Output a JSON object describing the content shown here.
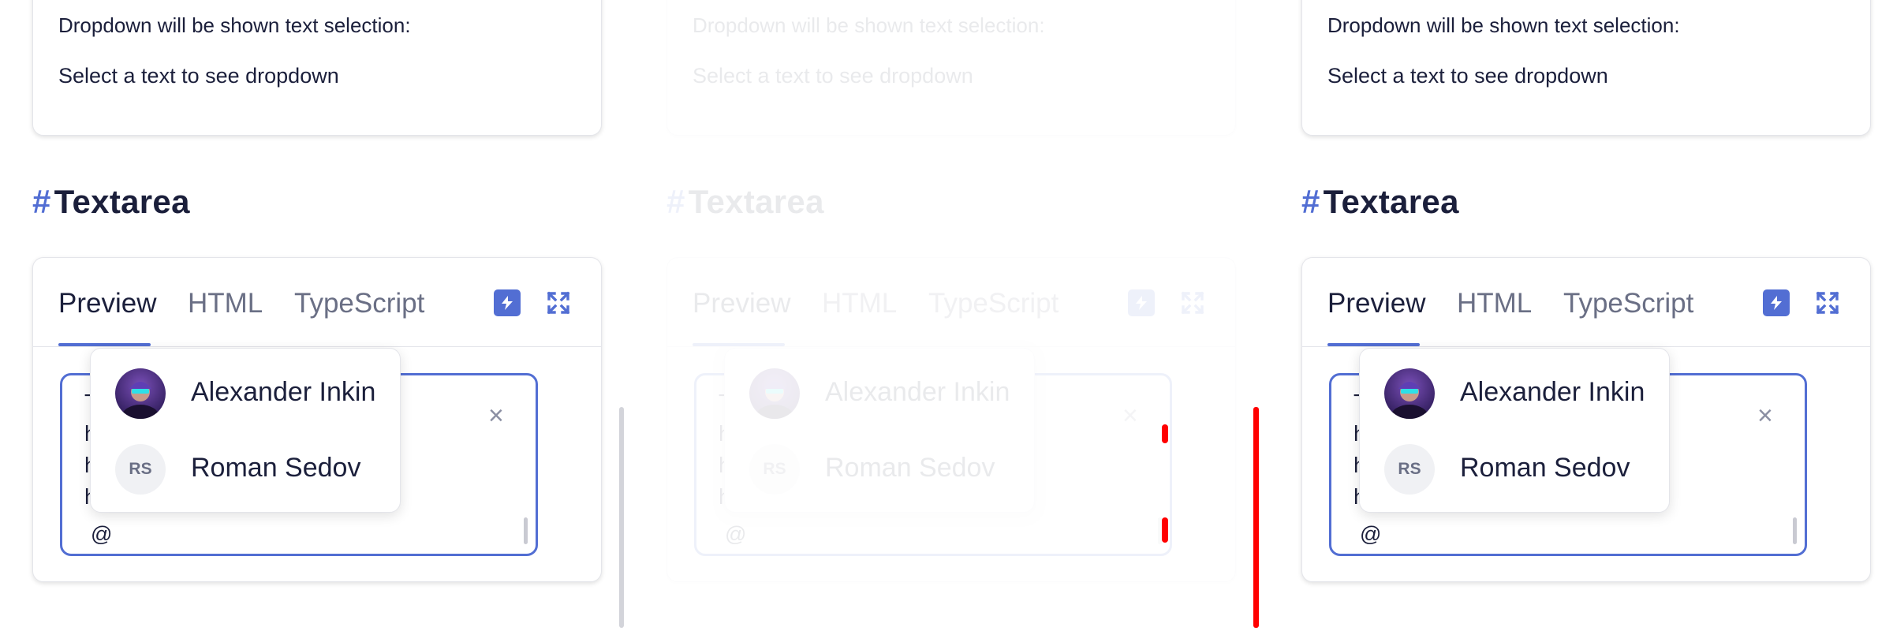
{
  "dropdown_hint": {
    "title": "Dropdown will be shown text selection:",
    "instruction": "Select a text to see dropdown"
  },
  "section": {
    "hash": "#",
    "title": "Textarea"
  },
  "tabs": [
    "Preview",
    "HTML",
    "TypeScript"
  ],
  "toolbar": {
    "stackblitz_icon": "lightning-bolt-icon",
    "fullscreen_icon": "expand-icon"
  },
  "textarea": {
    "lines": [
      "T",
      "h",
      "h",
      "h"
    ],
    "mention_trigger": "@",
    "clear_label": "×"
  },
  "mentions": [
    {
      "name": "Alexander Inkin",
      "avatar": "photo"
    },
    {
      "name": "Roman Sedov",
      "initials": "RS"
    }
  ],
  "colors": {
    "accent": "#526ed3",
    "text": "#1b1f3b",
    "muted": "#6a6f85",
    "error_marker": "#ff0000"
  }
}
